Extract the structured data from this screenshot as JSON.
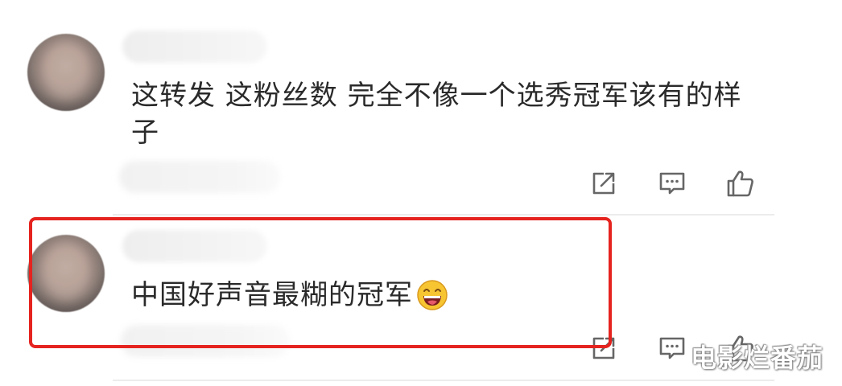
{
  "comments": [
    {
      "text": "这转发 这粉丝数 完全不像一个选秀冠军该有的样子",
      "has_emoji": false
    },
    {
      "text": "中国好声音最糊的冠军",
      "emoji_name": "laughing-grin-emoji",
      "highlighted": true
    }
  ],
  "actions": [
    "share-icon",
    "comment-icon",
    "like-icon"
  ],
  "watermark": "电影烂番茄",
  "colors": {
    "highlight_border": "#e5231f",
    "text": "#2a2a2a",
    "icon": "#666666",
    "divider": "#ececec"
  }
}
